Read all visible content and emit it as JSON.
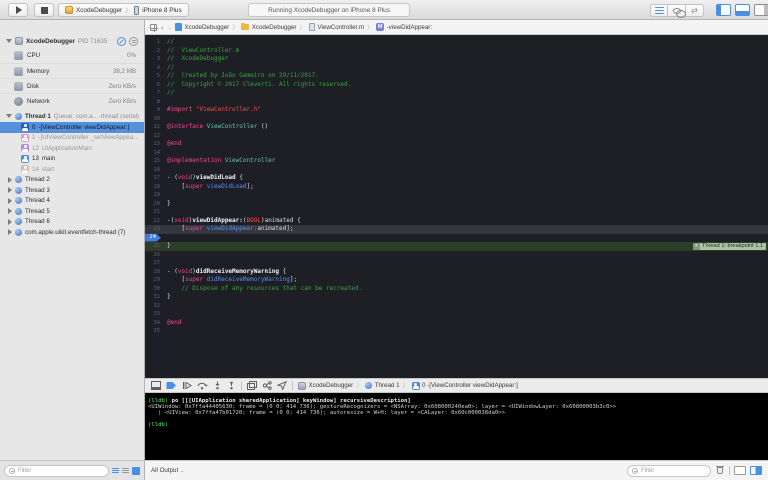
{
  "toolbar": {
    "status": "Running XcodeDebugger on iPhone 8 Plus",
    "scheme": "XcodeDebugger",
    "device": "iPhone 8 Plus"
  },
  "jump_bar": {
    "method_badge": "M",
    "crumbs": [
      {
        "label": "XcodeDebugger",
        "icon": "project"
      },
      {
        "label": "XcodeDebugger",
        "icon": "folder"
      },
      {
        "label": "ViewController.m",
        "icon": "file"
      },
      {
        "label": "-viewDidAppear:",
        "icon": "method"
      }
    ]
  },
  "debug_navigator": {
    "process": {
      "name": "XcodeDebugger",
      "pid": "PID 71635"
    },
    "gauges": [
      {
        "key": "cpu",
        "label": "CPU",
        "value": "0%"
      },
      {
        "key": "memory",
        "label": "Memory",
        "value": "38,2 MB"
      },
      {
        "key": "disk",
        "label": "Disk",
        "value": "Zero KB/s"
      },
      {
        "key": "network",
        "label": "Network",
        "value": "Zero KB/s"
      }
    ],
    "thread1": {
      "label": "Thread 1",
      "detail": "Queue: com.a…-thread (serial)"
    },
    "frames": [
      {
        "num": "0",
        "label": "-[ViewController viewDidAppear:]",
        "icon_color": "#2d5ea8",
        "selected": true,
        "dim": false
      },
      {
        "num": "1",
        "label": "-[UIViewController _setViewAppea…",
        "icon_color": "#e49ebc",
        "selected": false,
        "dim": true
      },
      {
        "num": "12",
        "label": "UIApplicationMain",
        "icon_color": "#b48ede",
        "selected": false,
        "dim": true
      },
      {
        "num": "13",
        "label": "main",
        "icon_color": "#4a90d9",
        "selected": false,
        "dim": false
      },
      {
        "num": "14",
        "label": "start",
        "icon_color": "#c9c2b2",
        "selected": false,
        "dim": true
      }
    ],
    "threads": [
      "Thread 2",
      "Thread 3",
      "Thread 4",
      "Thread 5",
      "Thread 6",
      "com.apple.uikit.eventfetch-thread (7)"
    ],
    "filter_placeholder": "Filter"
  },
  "editor": {
    "breakpoint_badge": "Thread 1: breakpoint 1.1",
    "lines": [
      {
        "n": 1,
        "s": [
          [
            "cm",
            "//"
          ]
        ]
      },
      {
        "n": 2,
        "s": [
          [
            "cm",
            "//  ViewController.m"
          ]
        ]
      },
      {
        "n": 3,
        "s": [
          [
            "cm",
            "//  XcodeDebugger"
          ]
        ]
      },
      {
        "n": 4,
        "s": [
          [
            "cm",
            "//"
          ]
        ]
      },
      {
        "n": 5,
        "s": [
          [
            "cm",
            "//  Created by João Gameiro on 29/11/2017."
          ]
        ]
      },
      {
        "n": 6,
        "s": [
          [
            "cm",
            "//  Copyright © 2017 Cleverti. All rights reserved."
          ]
        ]
      },
      {
        "n": 7,
        "s": [
          [
            "cm",
            "//"
          ]
        ]
      },
      {
        "n": 8,
        "s": []
      },
      {
        "n": 9,
        "s": [
          [
            "pre",
            "#import "
          ],
          [
            "str",
            "\"ViewController.h\""
          ]
        ]
      },
      {
        "n": 10,
        "s": []
      },
      {
        "n": 11,
        "s": [
          [
            "kw",
            "@interface"
          ],
          [
            "pl",
            " "
          ],
          [
            "cls",
            "ViewController"
          ],
          [
            "pl",
            " ()"
          ]
        ]
      },
      {
        "n": 12,
        "s": []
      },
      {
        "n": 13,
        "s": [
          [
            "kw",
            "@end"
          ]
        ]
      },
      {
        "n": 14,
        "s": []
      },
      {
        "n": 15,
        "s": [
          [
            "kw",
            "@implementation"
          ],
          [
            "pl",
            " "
          ],
          [
            "cls",
            "ViewController"
          ]
        ]
      },
      {
        "n": 16,
        "s": []
      },
      {
        "n": 17,
        "s": [
          [
            "pl",
            "- ("
          ],
          [
            "kw",
            "void"
          ],
          [
            "pl",
            ")"
          ],
          [
            "meth",
            "viewDidLoad"
          ],
          [
            "pl",
            " {"
          ]
        ]
      },
      {
        "n": 18,
        "s": [
          [
            "pl",
            "    ["
          ],
          [
            "kw",
            "super"
          ],
          [
            "pl",
            " "
          ],
          [
            "call",
            "viewDidLoad"
          ],
          [
            "pl",
            "];"
          ]
        ]
      },
      {
        "n": 19,
        "s": []
      },
      {
        "n": 20,
        "s": [
          [
            "pl",
            "}"
          ]
        ]
      },
      {
        "n": 21,
        "s": []
      },
      {
        "n": 22,
        "s": [
          [
            "pl",
            "-("
          ],
          [
            "kw",
            "void"
          ],
          [
            "pl",
            ")"
          ],
          [
            "meth",
            "viewDidAppear:"
          ],
          [
            "pl",
            "("
          ],
          [
            "typ",
            "BOOL"
          ],
          [
            "pl",
            ")animated {"
          ]
        ]
      },
      {
        "n": 23,
        "sel": true,
        "s": [
          [
            "pl",
            "    ["
          ],
          [
            "kw",
            "super"
          ],
          [
            "pl",
            " "
          ],
          [
            "call",
            "viewDidAppear:"
          ],
          [
            "pl",
            "animated];"
          ]
        ]
      },
      {
        "n": 24,
        "bp": true,
        "s": []
      },
      {
        "n": 25,
        "exec": true,
        "s": [
          [
            "pl",
            "}"
          ]
        ]
      },
      {
        "n": 26,
        "s": []
      },
      {
        "n": 27,
        "s": []
      },
      {
        "n": 28,
        "s": [
          [
            "pl",
            "- ("
          ],
          [
            "kw",
            "void"
          ],
          [
            "pl",
            ")"
          ],
          [
            "meth",
            "didReceiveMemoryWarning"
          ],
          [
            "pl",
            " {"
          ]
        ]
      },
      {
        "n": 29,
        "s": [
          [
            "pl",
            "    ["
          ],
          [
            "kw",
            "super"
          ],
          [
            "pl",
            " "
          ],
          [
            "call",
            "didReceiveMemoryWarning"
          ],
          [
            "pl",
            "];"
          ]
        ]
      },
      {
        "n": 30,
        "s": [
          [
            "cm",
            "    // Dispose of any resources that can be recreated."
          ]
        ]
      },
      {
        "n": 31,
        "s": [
          [
            "pl",
            "}"
          ]
        ]
      },
      {
        "n": 32,
        "s": []
      },
      {
        "n": 33,
        "s": []
      },
      {
        "n": 34,
        "s": [
          [
            "kw",
            "@end"
          ]
        ]
      },
      {
        "n": 35,
        "s": []
      }
    ]
  },
  "debug_bar": {
    "crumbs": [
      {
        "label": "XcodeDebugger",
        "icon": "app"
      },
      {
        "label": "Thread 1",
        "icon": "thread"
      },
      {
        "label": "0 -[ViewController viewDidAppear:]",
        "icon": "frame"
      }
    ]
  },
  "console": {
    "lines": [
      {
        "k": "cmd",
        "prompt": "(lldb) ",
        "text": "po [[[UIApplication sharedApplication] keyWindow] recursiveDescription]"
      },
      {
        "k": "out",
        "text": "<UIWindow: 0x7ffa44405630; frame = (0 0; 414 736); gestureRecognizers = <NSArray: 0x608000240ea0>; layer = <UIWindowLayer: 0x60800003b3c0>>"
      },
      {
        "k": "out",
        "text": "   | <UIView: 0x7ffa47b01720; frame = (0 0; 414 736); autoresize = W+H; layer = <CALayer: 0x60c000038da0>>"
      },
      {
        "k": "out",
        "text": ""
      },
      {
        "k": "cmd",
        "prompt": "(lldb) ",
        "text": ""
      }
    ],
    "output_mode": "All Output",
    "filter_placeholder": "Filter"
  },
  "colors": {
    "accent": "#4a90e2",
    "breakpoint_marker": "#3f7cdf",
    "exec_line_bg": "#2c3d2a",
    "exec_badge_bg": "#a9c4a3",
    "selected_row_bg": "#5490dc",
    "editor_bg": "#1e1f24",
    "console_bg": "#000000",
    "tokens": {
      "pl": "#dcdce1",
      "cm": "#36a43f",
      "kw": "#ff3f9b",
      "cls": "#69c5a7",
      "meth": "#eef1f5",
      "call": "#5c8ef5",
      "typ": "#ff4a4a",
      "pre": "#f74d85",
      "str": "#ff4a4a"
    }
  }
}
